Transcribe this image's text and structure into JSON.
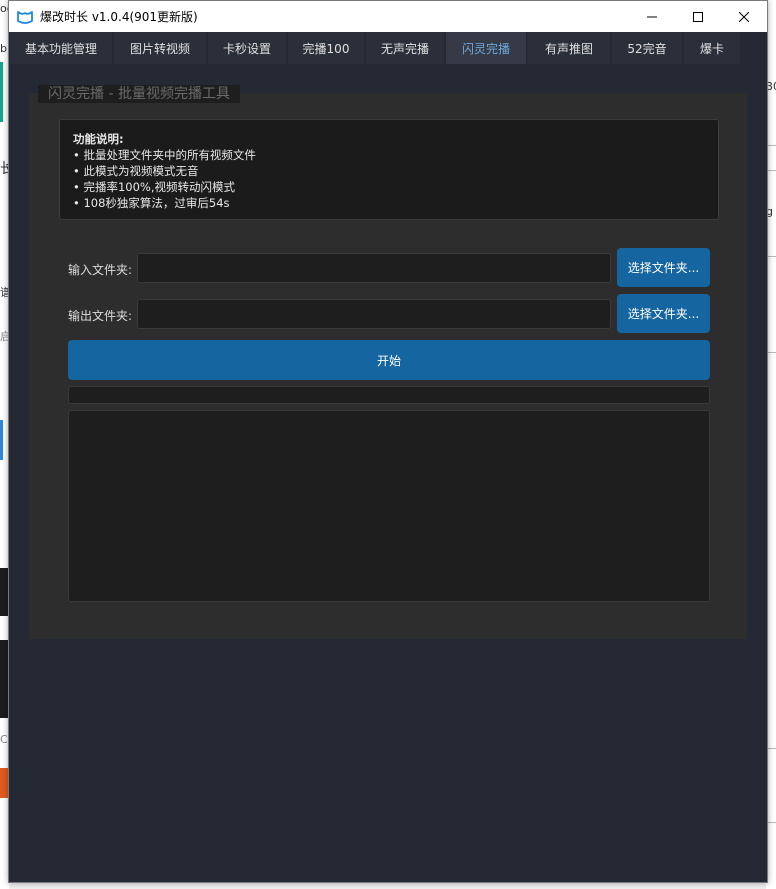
{
  "window": {
    "title": "爆改时长 v1.0.4(901更新版)"
  },
  "tabs": [
    {
      "label": "基本功能管理",
      "active": false
    },
    {
      "label": "图片转视频",
      "active": false
    },
    {
      "label": "卡秒设置",
      "active": false
    },
    {
      "label": "完播100",
      "active": false
    },
    {
      "label": "无声完播",
      "active": false
    },
    {
      "label": "闪灵完播",
      "active": true
    },
    {
      "label": "有声推图",
      "active": false
    },
    {
      "label": "52完音",
      "active": false
    },
    {
      "label": "爆卡",
      "active": false
    }
  ],
  "group": {
    "title": "闪灵完播 - 批量视频完播工具"
  },
  "info": {
    "heading": "功能说明:",
    "lines": [
      "• 批量处理文件夹中的所有视频文件",
      "• 此模式为视频模式无音",
      "• 完播率100%,视频转动闪模式",
      "• 108秒独家算法，过审后54s"
    ]
  },
  "form": {
    "input_label": "输入文件夹:",
    "input_value": "",
    "output_label": "输出文件夹:",
    "output_value": "",
    "browse_label": "选择文件夹...",
    "start_label": "开始"
  },
  "progress": {
    "percent": 0
  },
  "log": {
    "text": ""
  },
  "colors": {
    "accent": "#1565a0",
    "active_tab_text": "#6fa8dc",
    "window_bg": "#252933",
    "panel_bg": "#2d2d2d"
  },
  "background_fragments": {
    "left": [
      "od",
      "bil",
      "长",
      "谱",
      "启",
      "C"
    ],
    "right": [
      "30",
      "g"
    ]
  }
}
